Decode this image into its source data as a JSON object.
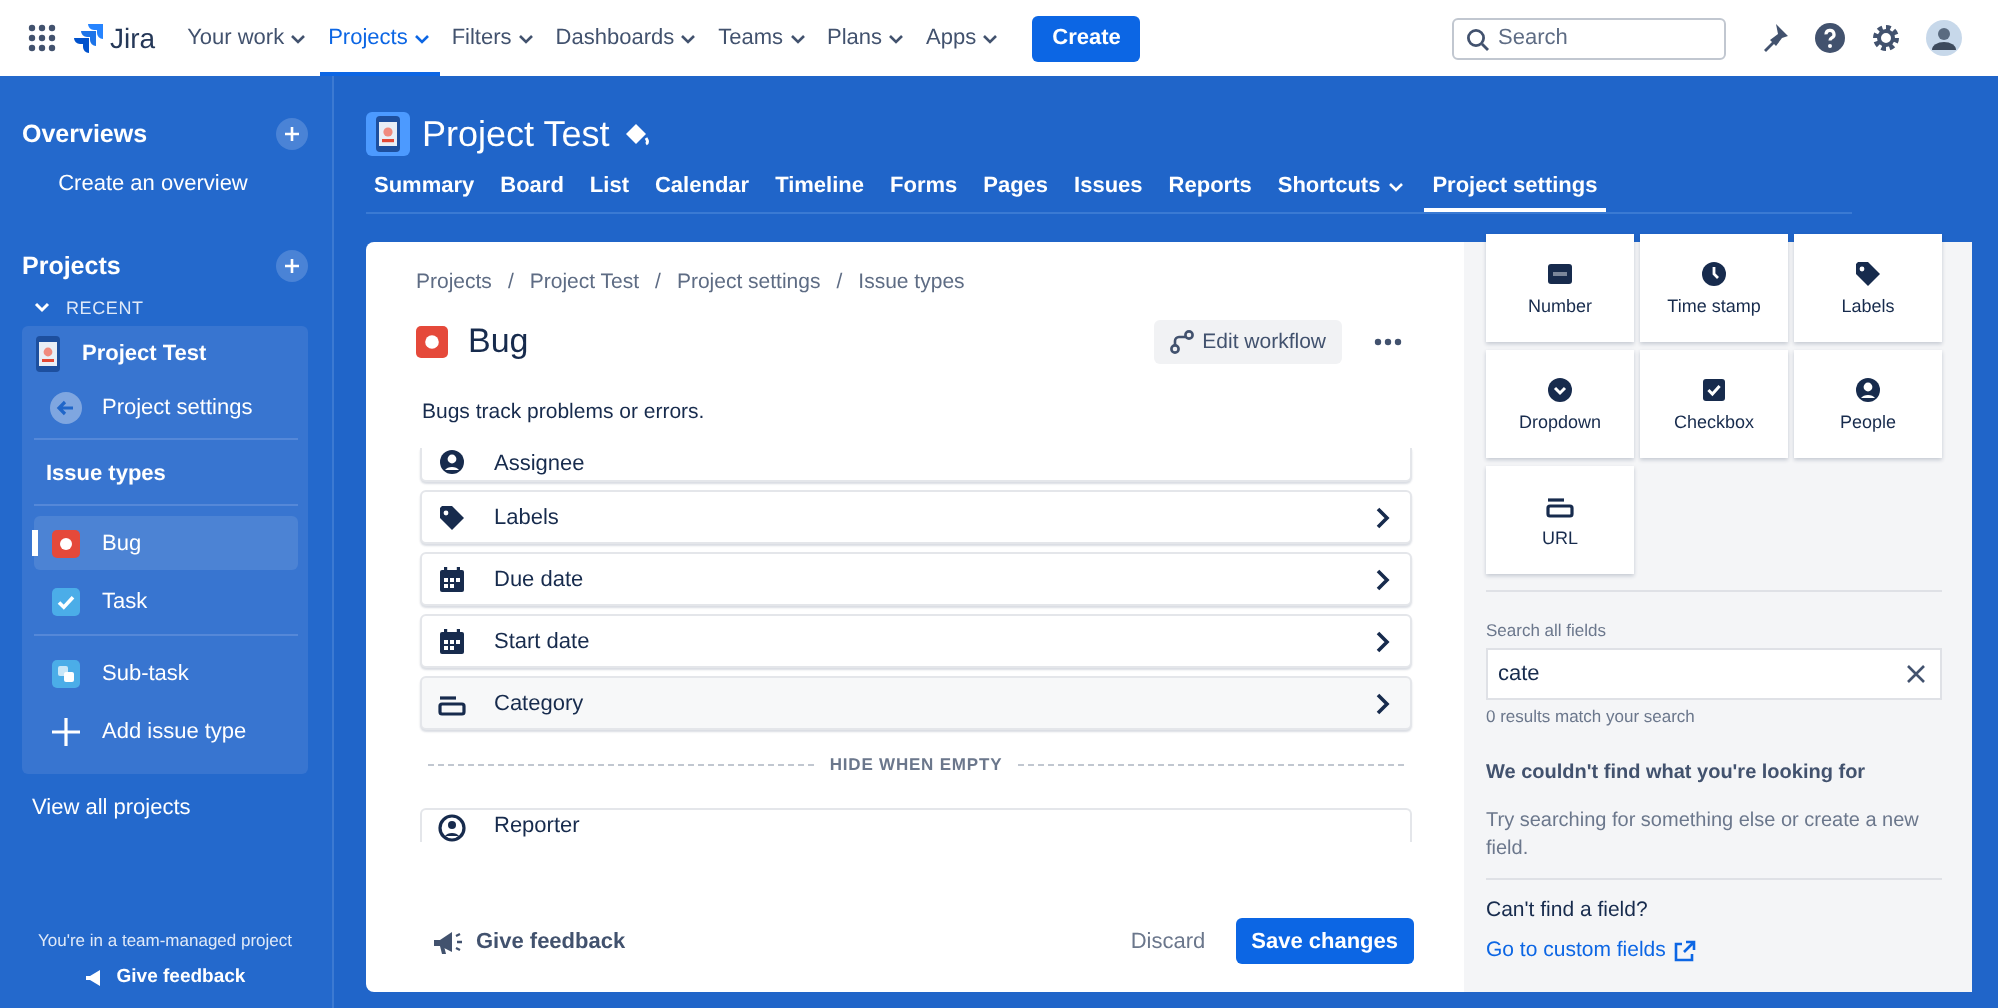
{
  "topnav": {
    "logo": "Jira",
    "items": [
      {
        "label": "Your work",
        "menu": true,
        "selected": false
      },
      {
        "label": "Projects",
        "menu": true,
        "selected": true
      },
      {
        "label": "Filters",
        "menu": true,
        "selected": false
      },
      {
        "label": "Dashboards",
        "menu": true,
        "selected": false
      },
      {
        "label": "Teams",
        "menu": true,
        "selected": false
      },
      {
        "label": "Plans",
        "menu": true,
        "selected": false
      },
      {
        "label": "Apps",
        "menu": true,
        "selected": false
      }
    ],
    "create": "Create",
    "search": {
      "placeholder": "Search"
    }
  },
  "sidebar": {
    "overviews": {
      "title": "Overviews",
      "action": "Create an overview"
    },
    "projects_title": "Projects",
    "recent": "RECENT",
    "project": "Project Test",
    "back": "Project settings",
    "section": "Issue types",
    "issue_types": [
      {
        "label": "Bug",
        "kind": "bug",
        "selected": true
      },
      {
        "label": "Task",
        "kind": "task",
        "selected": false
      },
      {
        "label": "Sub-task",
        "kind": "subtask",
        "selected": false
      },
      {
        "label": "Add issue type",
        "kind": "add",
        "selected": false
      }
    ],
    "view_all": "View all projects",
    "note": "You're in a team-managed project",
    "feedback": "Give feedback"
  },
  "project": {
    "title": "Project Test",
    "tabs": [
      {
        "label": "Summary",
        "selected": false
      },
      {
        "label": "Board",
        "selected": false
      },
      {
        "label": "List",
        "selected": false
      },
      {
        "label": "Calendar",
        "selected": false
      },
      {
        "label": "Timeline",
        "selected": false
      },
      {
        "label": "Forms",
        "selected": false
      },
      {
        "label": "Pages",
        "selected": false
      },
      {
        "label": "Issues",
        "selected": false
      },
      {
        "label": "Reports",
        "selected": false
      },
      {
        "label": "Shortcuts",
        "selected": false,
        "menu": true
      },
      {
        "label": "Project settings",
        "selected": true
      }
    ]
  },
  "breadcrumbs": [
    "Projects",
    "Project Test",
    "Project settings",
    "Issue types"
  ],
  "breadcrumb_separator": "/",
  "issue": {
    "title": "Bug",
    "edit_workflow": "Edit workflow",
    "description": "Bugs track problems or errors."
  },
  "fields": [
    {
      "label": "Assignee",
      "kind": "person",
      "clipped": true
    },
    {
      "label": "Labels",
      "kind": "tag"
    },
    {
      "label": "Due date",
      "kind": "date"
    },
    {
      "label": "Start date",
      "kind": "date"
    },
    {
      "label": "Category",
      "kind": "bar",
      "hovered": true
    }
  ],
  "divider": "HIDE WHEN EMPTY",
  "hidden_fields": [
    {
      "label": "Reporter",
      "kind": "person-up",
      "clipped": true
    }
  ],
  "footer": {
    "feedback": "Give feedback",
    "discard": "Discard",
    "save": "Save changes"
  },
  "panel": {
    "tiles": [
      {
        "label": "Number",
        "kind": "number"
      },
      {
        "label": "Time stamp",
        "kind": "clock"
      },
      {
        "label": "Labels",
        "kind": "tag"
      },
      {
        "label": "Dropdown",
        "kind": "dropdown"
      },
      {
        "label": "Checkbox",
        "kind": "checkbox"
      },
      {
        "label": "People",
        "kind": "person"
      },
      {
        "label": "URL",
        "kind": "bar"
      }
    ],
    "search_label": "Search all fields",
    "search_value": "cate",
    "results": "0 results match your search",
    "empty_title": "We couldn't find what you're looking for",
    "empty_text": "Try searching for something else or create a new field.",
    "cant_find": "Can't find a field?",
    "link": "Go to custom fields"
  }
}
